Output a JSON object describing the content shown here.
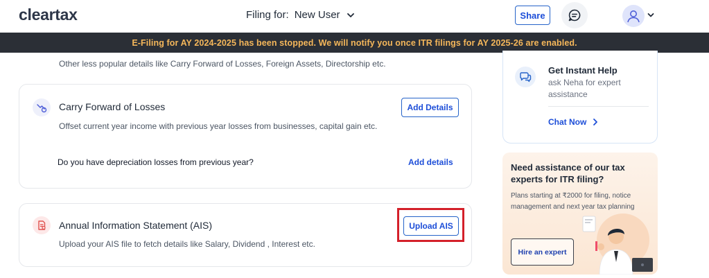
{
  "header": {
    "logo_text": "cleartax",
    "filing_for_label": "Filing for:",
    "filing_user": "New User",
    "share_label": "Share"
  },
  "banner": {
    "text": "E-Filing for AY 2024-2025 has been stopped. We will notify you once ITR filings for AY 2025-26 are enabled."
  },
  "intro": {
    "text": "Other less popular details like Carry Forward of Losses, Foreign Assets, Directorship etc."
  },
  "cards": {
    "carry_forward": {
      "title": "Carry Forward of Losses",
      "subtitle": "Offset current year income with previous year losses from businesses, capital gain etc.",
      "button_label": "Add Details",
      "question": "Do you have depreciation losses from previous year?",
      "question_link": "Add details"
    },
    "ais": {
      "title": "Annual Information Statement (AIS)",
      "subtitle": "Upload your AIS file to fetch details like Salary, Dividend , Interest etc.",
      "button_label": "Upload AIS"
    }
  },
  "help": {
    "title": "Get Instant Help",
    "subtitle": "ask Neha for expert assistance",
    "chat_label": "Chat Now"
  },
  "expert": {
    "title": "Need assistance of our tax experts for ITR filing?",
    "subtitle": "Plans starting at ₹2000 for filing, notice management and next year tax planning",
    "button_label": "Hire an expert"
  },
  "colors": {
    "accent": "#1d4ed8",
    "banner_bg": "#2b2f36",
    "banner_text": "#f5b75a",
    "highlight": "#d4202a"
  }
}
